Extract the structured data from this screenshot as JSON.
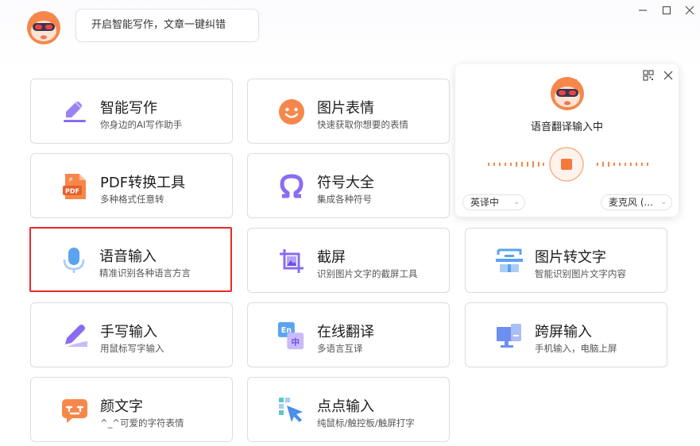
{
  "header": {
    "tip_text": "开启智能写作，文章一键纠错",
    "logo_icon": "mascot-robot-icon",
    "window_controls": [
      "minimize-icon",
      "maximize-icon",
      "close-icon"
    ]
  },
  "colors": {
    "accent_orange": "#f4793b",
    "accent_purple": "#8a6cf0",
    "accent_blue": "#4a8fe8",
    "selection_red": "#e8292b"
  },
  "tools": [
    {
      "title": "智能写作",
      "subtitle": "你身边的AI写作助手",
      "icon": "pen-edit-icon"
    },
    {
      "title": "图片表情",
      "subtitle": "快速获取你想要的表情",
      "icon": "smiley-face-icon"
    },
    {
      "title": "PDF转换工具",
      "subtitle": "多种格式任意转",
      "icon": "pdf-file-icon"
    },
    {
      "title": "符号大全",
      "subtitle": "集成各种符号",
      "icon": "omega-symbol-icon"
    },
    {
      "title": "语音输入",
      "subtitle": "精准识别各种语言方言",
      "icon": "microphone-icon",
      "selected": true
    },
    {
      "title": "截屏",
      "subtitle": "识别图片文字的截屏工具",
      "icon": "screenshot-crop-icon"
    },
    {
      "title": "图片转文字",
      "subtitle": "智能识别图片文字内容",
      "icon": "image-to-text-icon"
    },
    {
      "title": "手写输入",
      "subtitle": "用鼠标写字输入",
      "icon": "handwriting-pen-icon"
    },
    {
      "title": "在线翻译",
      "subtitle": "多语言互译",
      "icon": "translate-en-zh-icon"
    },
    {
      "title": "跨屏输入",
      "subtitle": "手机输入，电脑上屏",
      "icon": "phone-monitor-icon"
    },
    {
      "title": "颜文字",
      "subtitle": "^_^可爱的字符表情",
      "icon": "emoticon-bubble-icon"
    },
    {
      "title": "点点输入",
      "subtitle": "纯鼠标/触控板/触屏打字",
      "icon": "cursor-click-icon"
    }
  ],
  "voice_popup": {
    "status": "语音翻译输入中",
    "language_label": "英译中",
    "mic_label": "麦克风 (...",
    "qr_icon": "qr-code-icon",
    "close_icon": "close-icon",
    "record_icon": "stop-record-icon"
  }
}
